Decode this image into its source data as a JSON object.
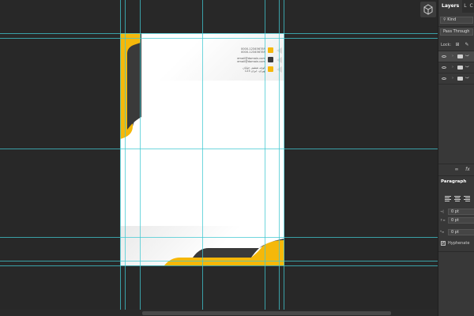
{
  "panel": {
    "tabs": [
      {
        "label": "Layers",
        "active": true
      },
      {
        "label": "L",
        "active": false
      },
      {
        "label": "C",
        "active": false
      }
    ],
    "filter_kind": "Kind",
    "blend_mode": "Pass Through",
    "lock_label": "Lock:",
    "layers": [
      {
        "name": "ب",
        "expanded_icon": "chevron-right-icon"
      },
      {
        "name": "ب",
        "expanded_icon": "chevron-right-icon"
      },
      {
        "name": "ب",
        "expanded_icon": "chevron-right-icon"
      }
    ],
    "footer": {
      "link": "∞",
      "fx": "fx"
    },
    "paragraph": {
      "title": "Paragraph",
      "indents": [
        "0 pt",
        "0 pt",
        "0 pt"
      ],
      "hyphenate_label": "Hyphenate",
      "hyphenate_checked": true
    }
  },
  "document": {
    "contact": {
      "phones": [
        "0000-123456789",
        "0000-123456789"
      ],
      "emails": [
        "email@domain.com",
        "email@domain.com"
      ],
      "address": [
        "کوچه ششم، خیابان",
        "تهران، ایران 123"
      ]
    },
    "colors": {
      "accent": "#f5b80a",
      "dark": "#3a3a3a",
      "icon_dark": "#3a3a3a"
    }
  },
  "colors": {
    "canvas_bg": "#282828",
    "panel_bg": "#383838",
    "guide": "#40c8d2"
  }
}
